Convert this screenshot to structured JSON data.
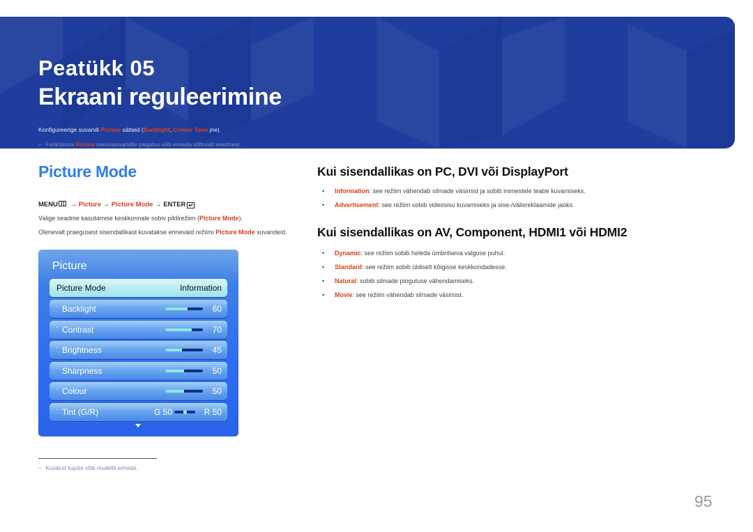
{
  "banner": {
    "chapter_label": "Peatükk  05",
    "chapter_title": "Ekraani reguleerimine",
    "intro": {
      "prefix": "Konfigureerige suvandi ",
      "term1": "Picture",
      "middle": " sätteid (",
      "term2": "Backlight",
      "sep": ", ",
      "term3": "Colour Tone",
      "suffix": " jne)."
    },
    "note": {
      "dash": "–",
      "prefix": "Funktsiooni ",
      "term": "Picture",
      "suffix": " menüüsuvandite paigutus võib erineda sõltuvalt seadmest."
    }
  },
  "section": {
    "title": "Picture Mode",
    "menu_path": {
      "menu": "MENU",
      "arrow": "→",
      "step1": "Picture",
      "step2": "Picture Mode",
      "enter": "ENTER",
      "enter_icon": "↵"
    },
    "para1": {
      "prefix": "Valige seadme kasutamise keskkonnale sobiv pildirežiim (",
      "term": "Picture Mode",
      "suffix": ")."
    },
    "para2": {
      "prefix": "Olenevalt praegusest sisendallikast kuvatakse erinevaid režiimi ",
      "term": "Picture Mode",
      "suffix": " suvandeid."
    }
  },
  "osd": {
    "title": "Picture",
    "selected": {
      "label": "Picture Mode",
      "value": "Information"
    },
    "items": [
      {
        "label": "Backlight",
        "value": "60",
        "level": 60
      },
      {
        "label": "Contrast",
        "value": "70",
        "level": 70
      },
      {
        "label": "Brightness",
        "value": "45",
        "level": 45
      },
      {
        "label": "Sharpness",
        "value": "50",
        "level": 50
      },
      {
        "label": "Colour",
        "value": "50",
        "level": 50
      }
    ],
    "tint": {
      "label": "Tint (G/R)",
      "g_value": "G 50",
      "r_value": "R 50",
      "balance": 50
    },
    "bullet": "·",
    "more_icon": "chevron-down"
  },
  "pc_section": {
    "heading": "Kui sisendallikas on PC, DVI või DisplayPort",
    "items": [
      {
        "term": "Information",
        "text": ": see režiim vähendab silmade väsimist ja sobib inimestele teabe kuvamiseks."
      },
      {
        "term": "Advertisement",
        "text": ": see režiim sobib videosisu kuvamiseks ja sise-/välisreklaamide jaoks."
      }
    ]
  },
  "av_section": {
    "heading": "Kui sisendallikas on AV, Component, HDMI1 või HDMI2",
    "items": [
      {
        "term": "Dynamic",
        "text": ": see režiim sobib heleda ümbritseva valguse puhul."
      },
      {
        "term": "Standard",
        "text": ": see režiim sobib üldiselt kõigisse keskkondadesse."
      },
      {
        "term": "Natural",
        "text": ": sobib silmade pingutuse vähendamiseks."
      },
      {
        "term": "Movie",
        "text": ": see režiim vähendab silmade väsimist."
      }
    ]
  },
  "bullet_char": "•",
  "footnote": {
    "dash": "–",
    "text": "Kuvatud kujutis võib mudeliti erineda."
  },
  "page_number": "95",
  "colors": {
    "banner_blue": "#1e3d9c",
    "accent_blue": "#2f7fe6",
    "highlight_red": "#d9401a"
  }
}
